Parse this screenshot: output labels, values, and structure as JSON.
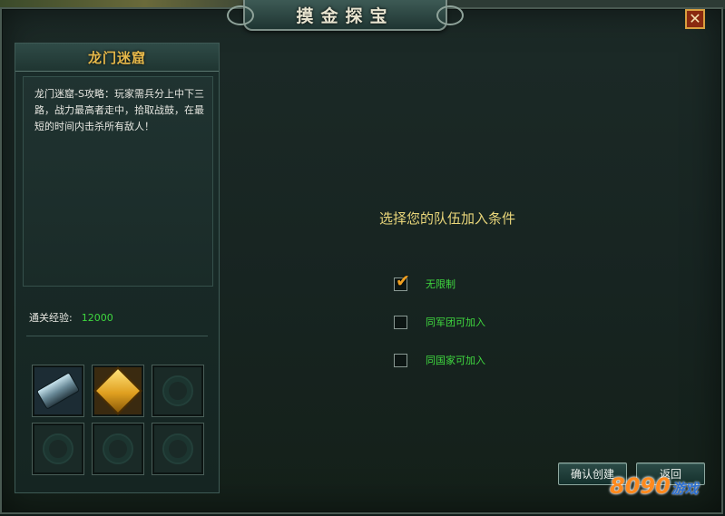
{
  "window": {
    "title": "摸金探宝",
    "close_label": "✕"
  },
  "left_panel": {
    "title": "龙门迷窟",
    "description": "龙门迷窟-S攻略：玩家需兵分上中下三路，战力最高者走中，拾取战鼓，在最短的时间内击杀所有敌人！",
    "exp_label": "通关经验:",
    "exp_value": "12000",
    "reward_slots": [
      {
        "icon": "iron-ingot-icon",
        "filled": true
      },
      {
        "icon": "gold-bar-icon",
        "filled": true
      },
      {
        "icon": "empty-slot-icon",
        "filled": false
      },
      {
        "icon": "empty-slot-icon",
        "filled": false
      },
      {
        "icon": "empty-slot-icon",
        "filled": false
      },
      {
        "icon": "empty-slot-icon",
        "filled": false
      }
    ]
  },
  "conditions": {
    "title": "选择您的队伍加入条件",
    "options": [
      {
        "label": "无限制",
        "checked": true
      },
      {
        "label": "同军团可加入",
        "checked": false
      },
      {
        "label": "同国家可加入",
        "checked": false
      }
    ],
    "checkmark": "✔"
  },
  "buttons": {
    "confirm_label": "确认创建",
    "back_label": "返回"
  },
  "watermark": {
    "number": "8090",
    "text": "游戏"
  },
  "colors": {
    "accent_gold": "#e6b84a",
    "option_green": "#3fd83f",
    "title_yellow": "#e9d67a"
  }
}
